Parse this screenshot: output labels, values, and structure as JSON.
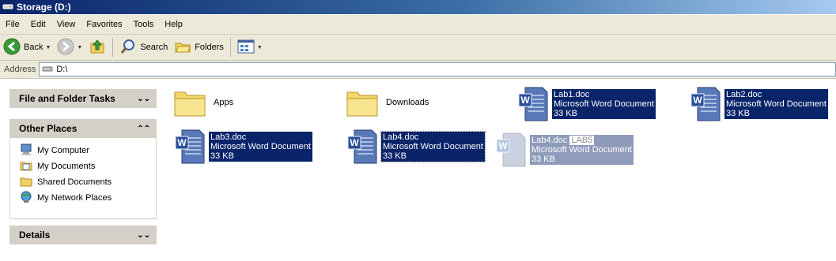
{
  "window": {
    "title": "Storage (D:)"
  },
  "menu": [
    "File",
    "Edit",
    "View",
    "Favorites",
    "Tools",
    "Help"
  ],
  "toolbar": {
    "back_label": "Back",
    "search_label": "Search",
    "folders_label": "Folders"
  },
  "address": {
    "label": "Address",
    "value": "D:\\"
  },
  "task_pane": {
    "file_folder_tasks": "File and Folder Tasks",
    "other_places": {
      "title": "Other Places",
      "items": [
        "My Computer",
        "My Documents",
        "Shared Documents",
        "My Network Places"
      ]
    },
    "details": "Details"
  },
  "files": [
    {
      "name": "Apps",
      "type": "folder"
    },
    {
      "name": "Downloads",
      "type": "folder"
    },
    {
      "name": "Lab1.doc",
      "type_label": "Microsoft Word Document",
      "size": "33 KB"
    },
    {
      "name": "Lab2.doc",
      "type_label": "Microsoft Word Document",
      "size": "33 KB"
    },
    {
      "name": "Lab3.doc",
      "type_label": "Microsoft Word Document",
      "size": "33 KB"
    },
    {
      "name": "Lab4.doc",
      "type_label": "Microsoft Word Document",
      "size": "33 KB"
    }
  ],
  "drag_ghost": {
    "name": "Lab4.doc",
    "type_label": "Microsoft Word Document",
    "size": "33 KB",
    "overlay": "LAB5"
  }
}
